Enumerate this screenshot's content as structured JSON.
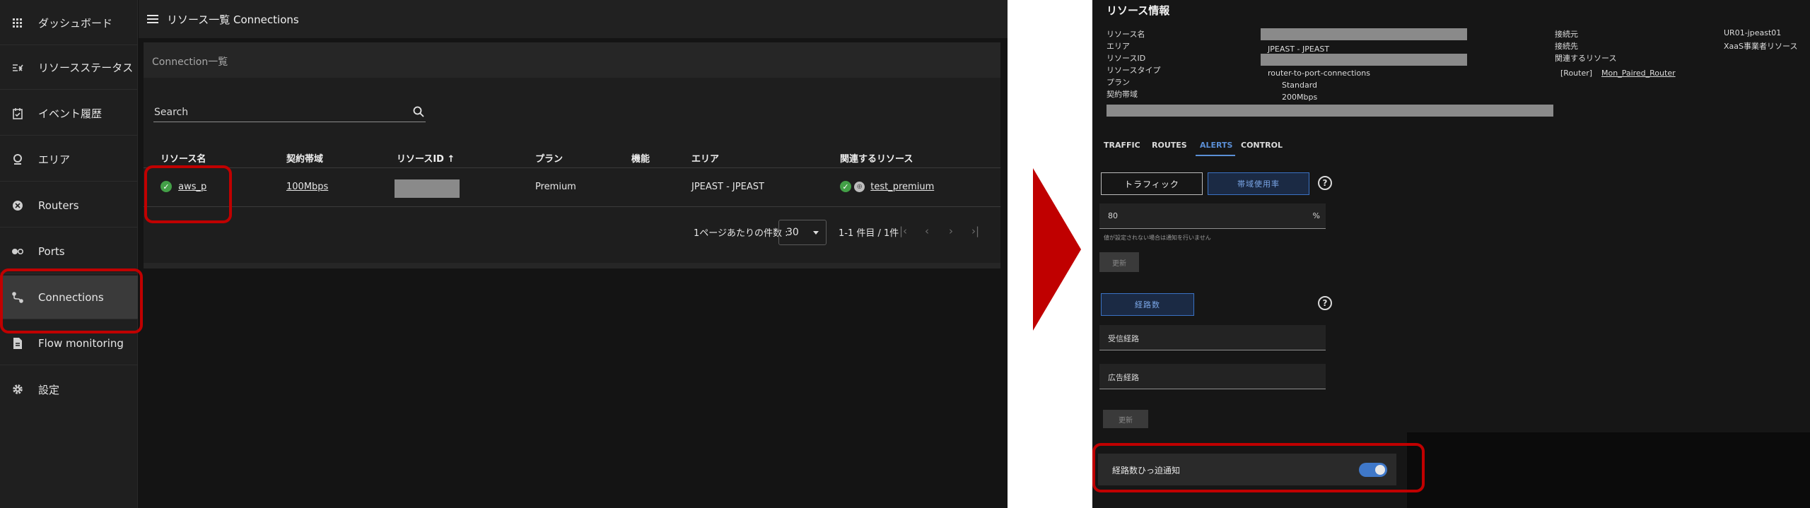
{
  "left": {
    "sidebar": {
      "items": [
        {
          "label": "ダッシュボード",
          "icon": "grid-icon"
        },
        {
          "label": "リソースステータス",
          "icon": "status-icon"
        },
        {
          "label": "イベント履歴",
          "icon": "calendar-check-icon"
        },
        {
          "label": "エリア",
          "icon": "map-pin-icon"
        },
        {
          "label": "Routers",
          "icon": "router-icon"
        },
        {
          "label": "Ports",
          "icon": "ports-icon"
        },
        {
          "label": "Connections",
          "icon": "connection-icon"
        },
        {
          "label": "Flow monitoring",
          "icon": "document-icon"
        },
        {
          "label": "設定",
          "icon": "gear-icon"
        }
      ]
    },
    "header": {
      "title": "リソース一覧 Connections"
    },
    "card": {
      "title": "Connection一覧",
      "search_placeholder": "Search",
      "columns": [
        "リソース名",
        "契約帯域",
        "リソースID",
        "プラン",
        "機能",
        "エリア",
        "関連するリソース"
      ],
      "sort_arrow": "↑",
      "row": {
        "name": "aws_p",
        "bandwidth": "100Mbps",
        "plan": "Premium",
        "area": "JPEAST - JPEAST",
        "related": "test_premium"
      },
      "pager": {
        "per_page_label": "1ページあたりの件数 :",
        "per_page_value": "30",
        "range": "1-1 件目 / 1件"
      }
    }
  },
  "right": {
    "title": "リソース情報",
    "info_left": [
      {
        "label": "リソース名",
        "value": ""
      },
      {
        "label": "エリア",
        "value": "JPEAST - JPEAST"
      },
      {
        "label": "リソースID",
        "value": ""
      },
      {
        "label": "リソースタイプ",
        "value": "router-to-port-connections"
      },
      {
        "label": "プラン",
        "value": "Standard"
      },
      {
        "label": "契約帯域",
        "value": "200Mbps"
      }
    ],
    "info_right": [
      {
        "label": "接続元",
        "value": "UR01-jpeast01"
      },
      {
        "label": "接続先",
        "value": "XaaS事業者リソース"
      },
      {
        "label": "関連するリソース",
        "value": ""
      }
    ],
    "related_prefix": "[Router]",
    "related_link": "Mon_Paired_Router",
    "tabs": [
      "TRAFFIC",
      "ROUTES",
      "ALERTS",
      "CONTROL"
    ],
    "active_tab": "ALERTS",
    "traffic_button": "トラフィック",
    "bandwidth_button": "帯域使用率",
    "threshold_value": "80",
    "threshold_unit": "%",
    "threshold_hint": "値が設定されない場合は通知を行いません",
    "update_label": "更新",
    "routes_button": "経路数",
    "received_routes": "受信経路",
    "advertised_routes": "広告経路",
    "toggle_label": "経路数ひっ迫通知",
    "toggle_on": true
  },
  "colors": {
    "highlight": "#c00000",
    "accent": "#3f78c9",
    "success": "#43a047"
  }
}
